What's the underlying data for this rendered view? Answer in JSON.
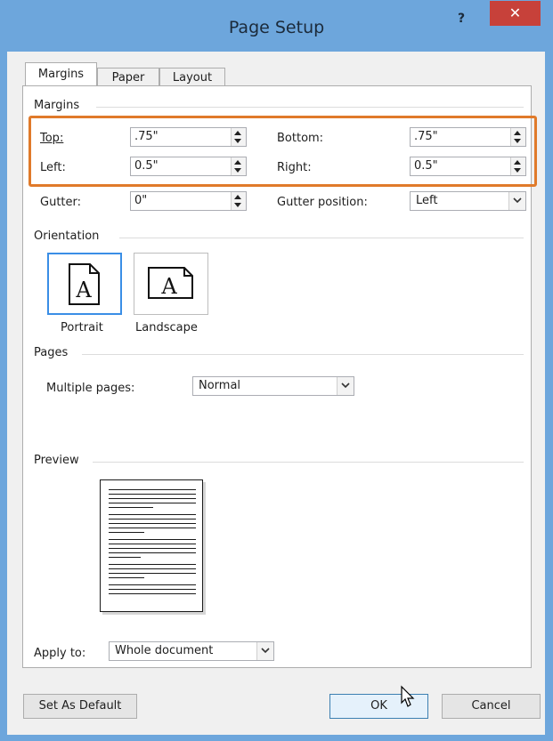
{
  "window": {
    "title": "Page Setup",
    "help": "?",
    "close": "✕"
  },
  "tabs": [
    {
      "label": "Margins"
    },
    {
      "label": "Paper"
    },
    {
      "label": "Layout"
    }
  ],
  "margins": {
    "group": "Margins",
    "top": {
      "label": "Top:",
      "value": ".75\""
    },
    "bottom": {
      "label": "Bottom:",
      "value": ".75\""
    },
    "left": {
      "label": "Left:",
      "value": "0.5\""
    },
    "right": {
      "label": "Right:",
      "value": "0.5\""
    },
    "gutter": {
      "label": "Gutter:",
      "value": "0\""
    },
    "gutter_position": {
      "label": "Gutter position:",
      "value": "Left"
    }
  },
  "orientation": {
    "group": "Orientation",
    "portrait": "Portrait",
    "landscape": "Landscape",
    "selected": "Portrait"
  },
  "pages": {
    "group": "Pages",
    "multiple_label": "Multiple pages:",
    "multiple_value": "Normal"
  },
  "preview": {
    "group": "Preview",
    "apply_label": "Apply to:",
    "apply_value": "Whole document"
  },
  "buttons": {
    "set_default": "Set As Default",
    "ok": "OK",
    "cancel": "Cancel"
  },
  "colors": {
    "frame": "#6da6dc",
    "close": "#c7413a",
    "highlight": "#e07a2a",
    "selection": "#3a8ee6"
  }
}
